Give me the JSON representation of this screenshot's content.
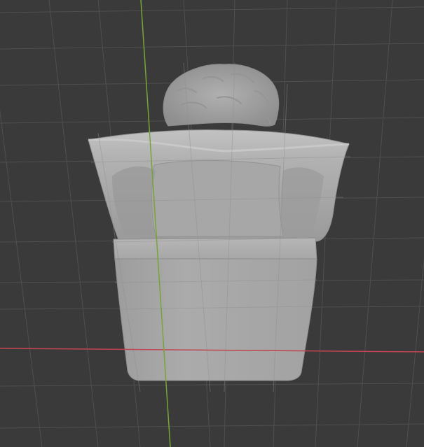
{
  "viewport": {
    "background": "#3a3a3a",
    "grid_color": "#555555",
    "x_axis_color": "#c0454f",
    "y_axis_color": "#7aa33a",
    "mesh_color": "#a9a9a9",
    "mesh_highlight": "#c4c4c4",
    "mesh_shadow": "#8a8a8a"
  }
}
